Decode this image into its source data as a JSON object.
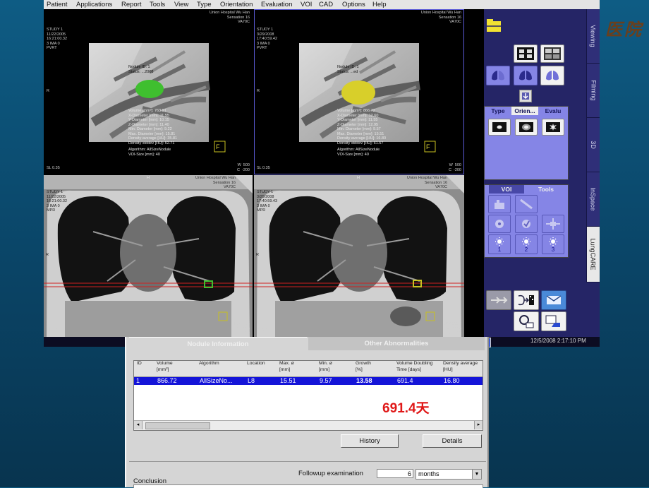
{
  "menu": [
    "Patient",
    "Applications",
    "Report",
    "Tools",
    "View",
    "Type",
    "Orientation",
    "Evaluation",
    "VOI",
    "CAD",
    "Options",
    "Help"
  ],
  "viewports": {
    "vp1": {
      "hospital": "Union Hospital Wu Han",
      "scanner": "Sensation 16",
      "model": "VA70C",
      "study": "STUDY 1",
      "date": "11/22/2005",
      "time": "16:21:00.32",
      "ima": "3 IMA 0",
      "mode": "PVRT",
      "nodule_lines": "Nodule ID: 1\nStatus: ...2008",
      "measurements": "Volume [mm³]: 763.91\nX-Diameter [mm]: 11.55\nY-Diameter [mm]: 10.15\nZ-Diameter [mm]: 11.40\nMin. Diameter [mm]: 9.22\nMax. Diameter [mm]: 15.81\nDensity average [HU]: 35.81\nDensity stddev [HU]: 52.71",
      "algorithm": "Algorithm: AllSizeNodule\nVOI-Size [mm]: 40",
      "sl": "SL 0.35",
      "wl": "W  500\nC  -200",
      "orient": "R",
      "marker": "F"
    },
    "vp2": {
      "hospital": "Union Hospital Wu Han",
      "scanner": "Sensation 16",
      "model": "VA70C",
      "study": "STUDY 1",
      "date": "3/29/2008",
      "time": "17:40:59.42",
      "ima": "3 IMA 0",
      "mode": "PVRT",
      "nodule_lines": "Nodule ID: 1\nStatus: ...ed",
      "measurements": "Volume [mm³]: 866.72\nX-Diameter [mm]: 12.60\nY-Diameter [mm]: 11.55\nZ-Diameter [mm]: 12.95\nMin. Diameter [mm]: 9.57\nMax. Diameter [mm]: 15.51\nDensity average [HU]: 16.80\nDensity stddev [HU]: 61.57",
      "algorithm": "Algorithm: AllSizeNodule\nVOI-Size [mm]: 40",
      "sl": "SL 0.35",
      "wl": "W  500\nC  -200",
      "orient": "R",
      "marker": "F"
    },
    "vp3": {
      "hospital": "Union Hospital Wu Han",
      "scanner": "Sensation 16",
      "model": "VA70C",
      "study": "STUDY 1",
      "date": "11/22/2005",
      "time": "16:21:00.32",
      "ima": "3 IMA 0",
      "mode": "MPR",
      "sl": "SL 2.0",
      "orient_top": "H",
      "orient_left": "R",
      "sp": "SP A153.6\nW  1500\nC  -400"
    },
    "vp4": {
      "hospital": "Union Hospital Wu Han",
      "scanner": "Sensation 16",
      "model": "VA70C",
      "study": "STUDY 1",
      "date": "3/29/2008",
      "time": "17:40:59.43",
      "ima": "3 IMA 0",
      "mode": "MPR",
      "sl": "SL 2.0",
      "orient_top": "H",
      "orient_left": "R",
      "sp": "SP A161.7\nW  1500\nC  -400"
    }
  },
  "side_tabs": [
    "Viewing",
    "Filming",
    "3D",
    "InSpace",
    "LungCARE"
  ],
  "side_tabs_active": "LungCARE",
  "type_panel": {
    "tabs": [
      "Type",
      "Orien...",
      "Evalu"
    ]
  },
  "voi_panel": {
    "tabs": [
      "VOI",
      "Tools"
    ]
  },
  "status_time": "12/5/2008  2:17:10 PM",
  "dialog": {
    "tab_nodule": "Nodule Information",
    "tab_other": "Other Abnormalities",
    "columns": [
      "ID",
      "Volume\n[mm³]",
      "Algorithm",
      "Location",
      "Max. ø\n[mm]",
      "Min. ø\n[mm]",
      "Growth\n[%]",
      "Volume Doubling\nTime [days]",
      "Density average\n[HU]"
    ],
    "row": [
      "1",
      "866.72",
      "AllSizeNo...",
      "L8",
      "15.51",
      "9.57",
      "13.58",
      "691.4",
      "16.80"
    ],
    "annotation": "691.4天",
    "btn_history": "History",
    "btn_details": "Details",
    "followup_label": "Followup examination",
    "followup_value": "6",
    "followup_unit": "months",
    "conclusion_label": "Conclusion"
  },
  "watermark": "医院",
  "colors": {
    "nodule_prior": "#3fbf2f",
    "nodule_current": "#d8cf2a",
    "panel": "#252566",
    "selected_row": "#1414d8",
    "annotation": "#e01818"
  }
}
